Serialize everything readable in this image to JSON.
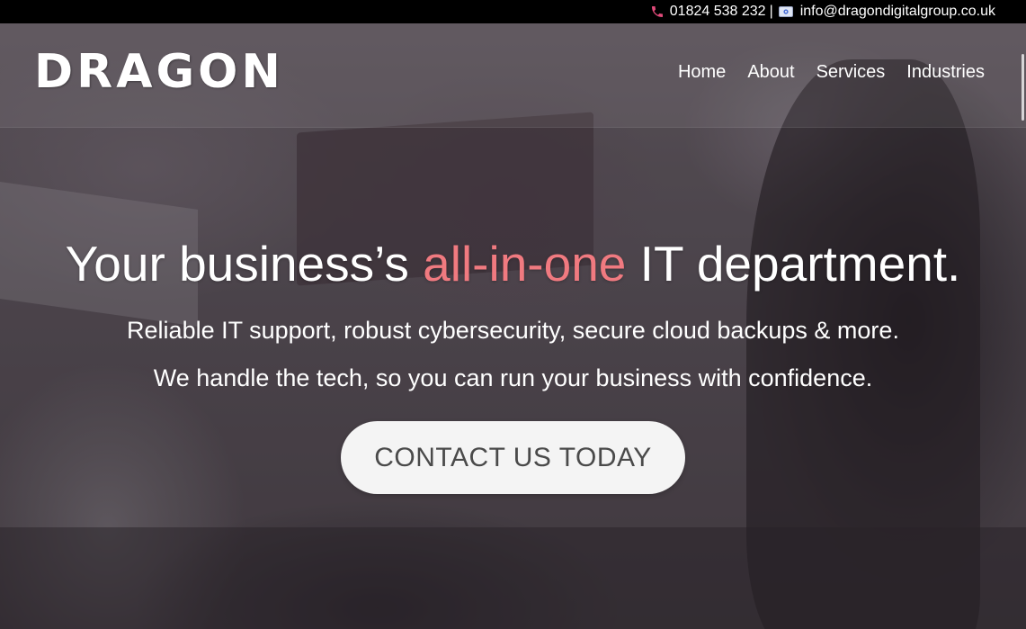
{
  "topbar": {
    "phone_icon": "phone-icon",
    "phone": "01824 538 232",
    "separator": "|",
    "email_icon": "mail-icon",
    "email": "info@dragondigitalgroup.co.uk"
  },
  "header": {
    "logo_text": "DRAGON",
    "nav": [
      {
        "label": "Home"
      },
      {
        "label": "About"
      },
      {
        "label": "Services"
      },
      {
        "label": "Industries"
      }
    ]
  },
  "hero": {
    "headline_before": "Your business’s ",
    "headline_accent": "all-in-one",
    "headline_after": " IT department.",
    "subline_1": "Reliable IT support, robust cybersecurity, secure cloud backups & more.",
    "subline_2": "We handle the tech, so you can run your business with confidence.",
    "cta_label": "CONTACT US TODAY"
  },
  "colors": {
    "topbar_bg": "#000000",
    "accent": "#f07a80",
    "phone_icon": "#e04a7a",
    "cta_bg": "#f4f4f4",
    "cta_text": "#4a4a4a"
  }
}
